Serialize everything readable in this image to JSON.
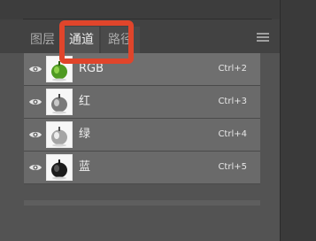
{
  "tabs": [
    {
      "label": "图层"
    },
    {
      "label": "通道"
    },
    {
      "label": "路径"
    }
  ],
  "active_tab": "通道",
  "channels": [
    {
      "name": "RGB",
      "shortcut": "Ctrl+2"
    },
    {
      "name": "红",
      "shortcut": "Ctrl+3"
    },
    {
      "name": "绿",
      "shortcut": "Ctrl+4"
    },
    {
      "name": "蓝",
      "shortcut": "Ctrl+5"
    }
  ],
  "icons": {
    "visibility": "eye-icon",
    "panel_menu": "hamburger-menu-icon"
  },
  "colors": {
    "highlight": "#e0452b",
    "panel_bg": "#535353",
    "row_bg": "#6a6a6a"
  }
}
